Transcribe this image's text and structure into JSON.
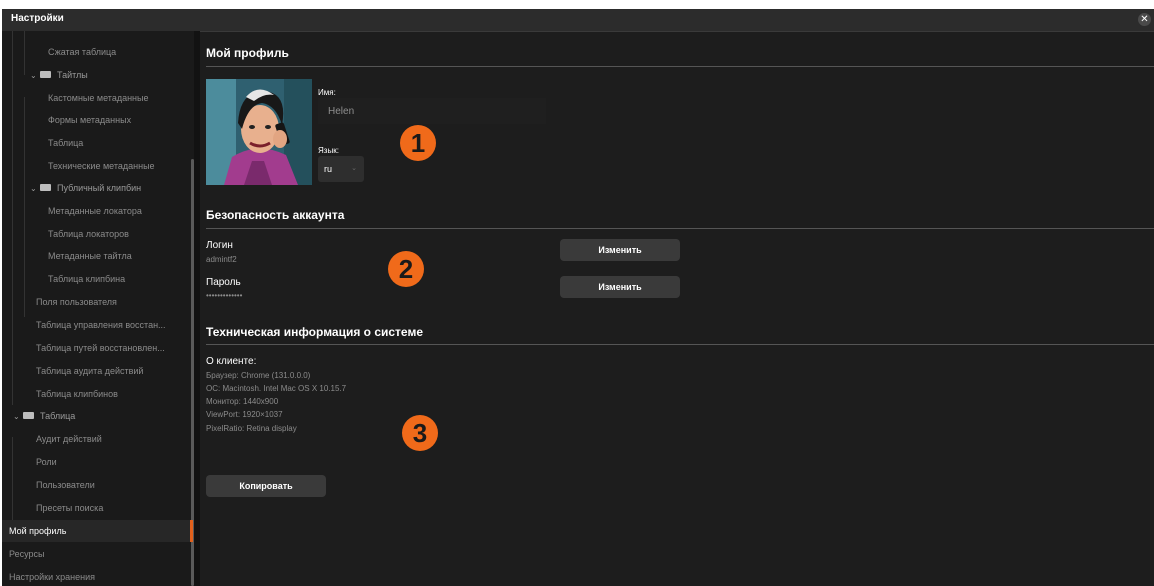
{
  "window": {
    "title": "Настройки",
    "close_glyph": "✕"
  },
  "sidebar": {
    "items": [
      {
        "label": "Сжатая таблица"
      },
      {
        "label": "Тайтлы",
        "caret": "⌄"
      },
      {
        "label": "Кастомные метаданные"
      },
      {
        "label": "Формы метаданных"
      },
      {
        "label": "Таблица"
      },
      {
        "label": "Технические метаданные"
      },
      {
        "label": "Публичный клипбин",
        "caret": "⌄"
      },
      {
        "label": "Метаданные локатора"
      },
      {
        "label": "Таблица локаторов"
      },
      {
        "label": "Метаданные тайтла"
      },
      {
        "label": "Таблица клипбина"
      },
      {
        "label": "Поля пользователя"
      },
      {
        "label": "Таблица управления восстан..."
      },
      {
        "label": "Таблица путей восстановлен..."
      },
      {
        "label": "Таблица аудита действий"
      },
      {
        "label": "Таблица клипбинов"
      },
      {
        "label": "Таблица",
        "caret": "⌄"
      },
      {
        "label": "Аудит действий"
      },
      {
        "label": "Роли"
      },
      {
        "label": "Пользователи"
      },
      {
        "label": "Пресеты поиска"
      },
      {
        "label": "Мой профиль"
      },
      {
        "label": "Ресурсы"
      },
      {
        "label": "Настройки хранения"
      }
    ]
  },
  "profile": {
    "title": "Мой профиль",
    "name_label": "Имя:",
    "name_value": "Helen",
    "lang_label": "Язык:",
    "lang_value": "ru",
    "lang_chevron": "⌄"
  },
  "security": {
    "title": "Безопасность аккаунта",
    "login_label": "Логин",
    "login_value": "admintf2",
    "password_label": "Пароль",
    "password_value": "•••••••••••••",
    "change_label": "Изменить"
  },
  "tech": {
    "title": "Техническая информация о системе",
    "client_label": "О клиенте:",
    "lines": [
      "Браузер: Chrome (131.0.0.0)",
      "ОС: Macintosh. Intel Mac OS X 10.15.7",
      "Монитор: 1440x900",
      "ViewPort: 1920×1037",
      "PixelRatio: Retina display"
    ],
    "copy_label": "Копировать"
  },
  "badges": [
    "1",
    "2",
    "3"
  ],
  "colors": {
    "accent": "#f06a1a",
    "background": "#1d1d1d",
    "sidebar_active": "#e0601c"
  }
}
